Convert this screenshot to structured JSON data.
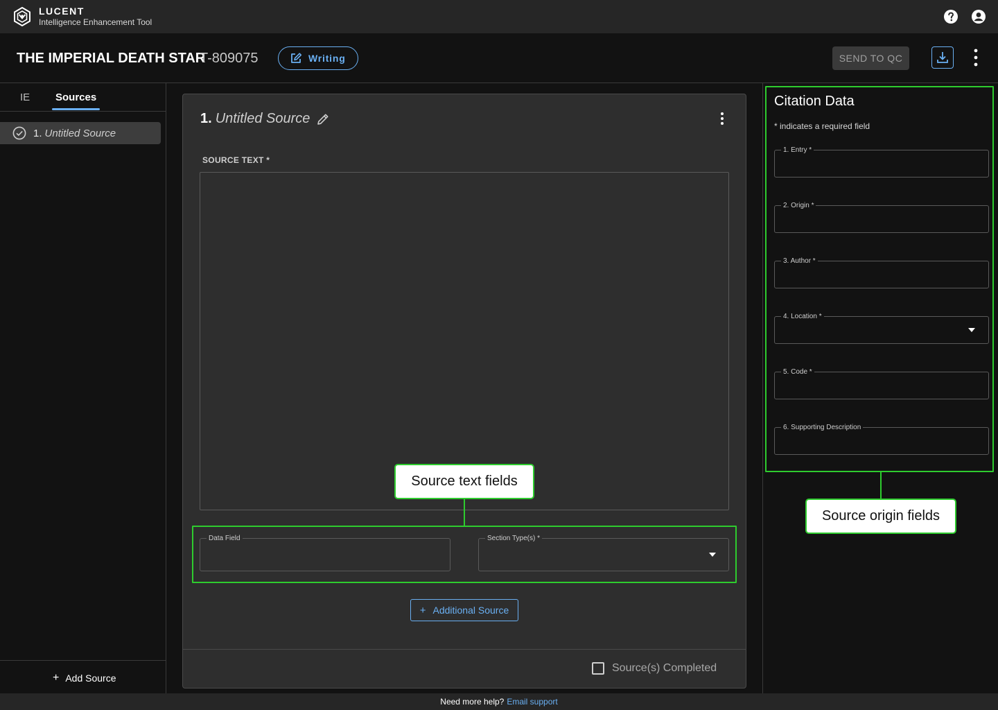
{
  "app": {
    "brand_name": "LUCENT",
    "brand_subtitle": "Intelligence Enhancement Tool",
    "icons": [
      "help-icon",
      "account-icon"
    ]
  },
  "header": {
    "doc_title": "THE IMPERIAL DEATH STAR",
    "doc_id": "T-809075",
    "status_label": "Writing",
    "send_qc_label": "SEND TO QC",
    "accent_color": "#6ab0f3"
  },
  "sidebar": {
    "tabs": [
      {
        "label": "IE",
        "active": false
      },
      {
        "label": "Sources",
        "active": true
      }
    ],
    "items": [
      {
        "number": "1.",
        "name": "Untitled Source",
        "selected": true
      }
    ],
    "add_source_label": "Add Source"
  },
  "source_card": {
    "number": "1.",
    "name": "Untitled Source",
    "source_text_label": "SOURCE TEXT *",
    "source_text_value": "",
    "data_field_label": "Data Field",
    "data_field_value": "",
    "section_types_label": "Section Type(s) *",
    "section_types_value": "",
    "additional_source_label": "Additional Source",
    "completed_label": "Source(s) Completed",
    "completed_checked": false
  },
  "citation": {
    "title": "Citation Data",
    "required_note": "* indicates a required field",
    "fields": [
      {
        "label": "1. Entry *",
        "value": "",
        "type": "text"
      },
      {
        "label": "2. Origin *",
        "value": "",
        "type": "text"
      },
      {
        "label": "3. Author *",
        "value": "",
        "type": "text"
      },
      {
        "label": "4. Location *",
        "value": "",
        "type": "select"
      },
      {
        "label": "5. Code *",
        "value": "",
        "type": "text"
      },
      {
        "label": "6. Supporting Description",
        "value": "",
        "type": "text"
      }
    ]
  },
  "annotations": {
    "source_text_callout": "Source text fields",
    "source_origin_callout": "Source origin fields",
    "highlight_color": "#2ecc2e"
  },
  "footer": {
    "help_text": "Need more help?",
    "help_link": "Email support"
  }
}
